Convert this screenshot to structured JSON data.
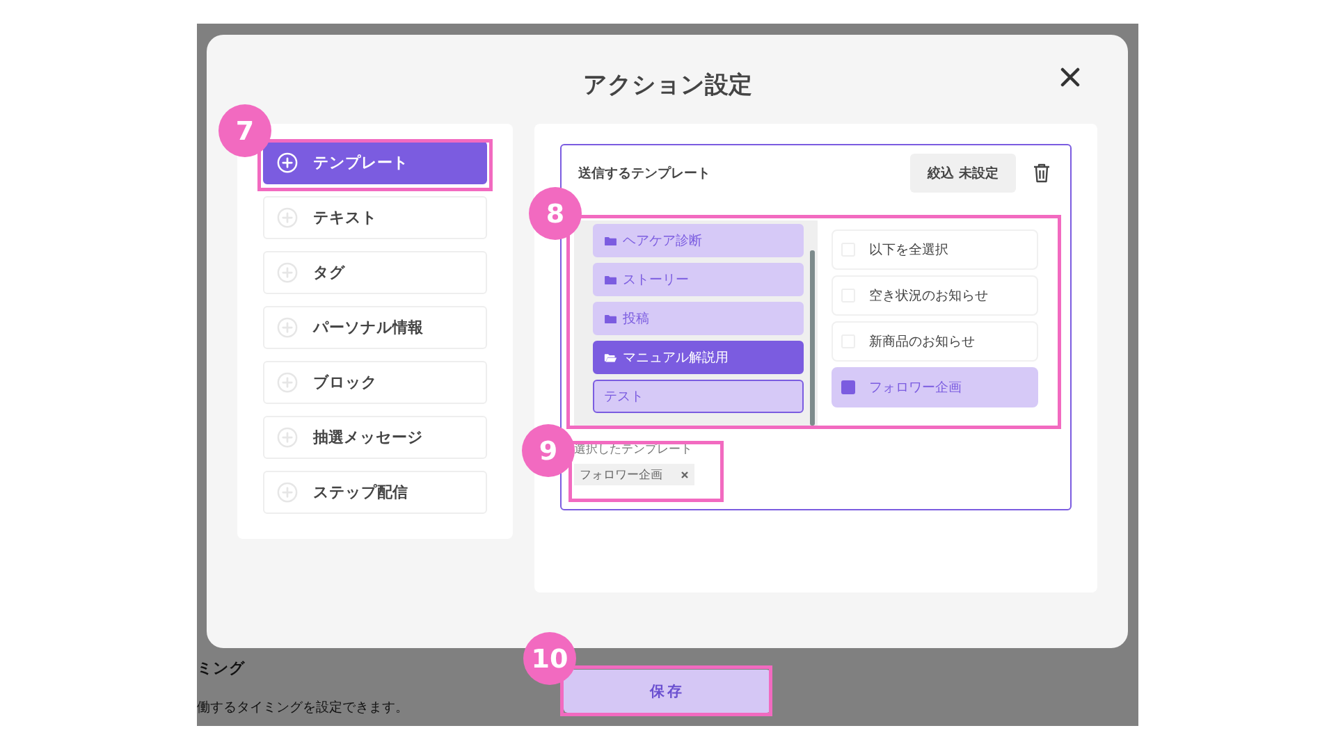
{
  "dialog": {
    "title": "アクション設定",
    "action_types": [
      {
        "label": "テンプレート",
        "selected": true
      },
      {
        "label": "テキスト",
        "selected": false
      },
      {
        "label": "タグ",
        "selected": false
      },
      {
        "label": "パーソナル情報",
        "selected": false
      },
      {
        "label": "ブロック",
        "selected": false
      },
      {
        "label": "抽選メッセージ",
        "selected": false
      },
      {
        "label": "ステップ配信",
        "selected": false
      }
    ],
    "template_panel": {
      "title": "送信するテンプレート",
      "filter_button": "絞込 未設定",
      "folders": [
        {
          "label": "ヘアケア診断",
          "kind": "folder",
          "selected": false,
          "focused": false
        },
        {
          "label": "ストーリー",
          "kind": "folder",
          "selected": false,
          "focused": false
        },
        {
          "label": "投稿",
          "kind": "folder",
          "selected": false,
          "focused": false
        },
        {
          "label": "マニュアル解説用",
          "kind": "folder",
          "selected": true,
          "focused": false
        },
        {
          "label": "テスト",
          "kind": "text",
          "selected": false,
          "focused": true
        }
      ],
      "templates": [
        {
          "label": "以下を全選択",
          "checked": false
        },
        {
          "label": "空き状況のお知らせ",
          "checked": false
        },
        {
          "label": "新商品のお知らせ",
          "checked": false
        },
        {
          "label": "フォロワー企画",
          "checked": true
        }
      ],
      "selected_label": "選択したテンプレート",
      "selected_tags": [
        {
          "label": "フォロワー企画"
        }
      ]
    }
  },
  "background": {
    "heading": "ミング",
    "description": "働するタイミングを設定できます。"
  },
  "save_button": "保存",
  "annotations": [
    {
      "number": "7"
    },
    {
      "number": "8"
    },
    {
      "number": "9"
    },
    {
      "number": "10"
    }
  ]
}
